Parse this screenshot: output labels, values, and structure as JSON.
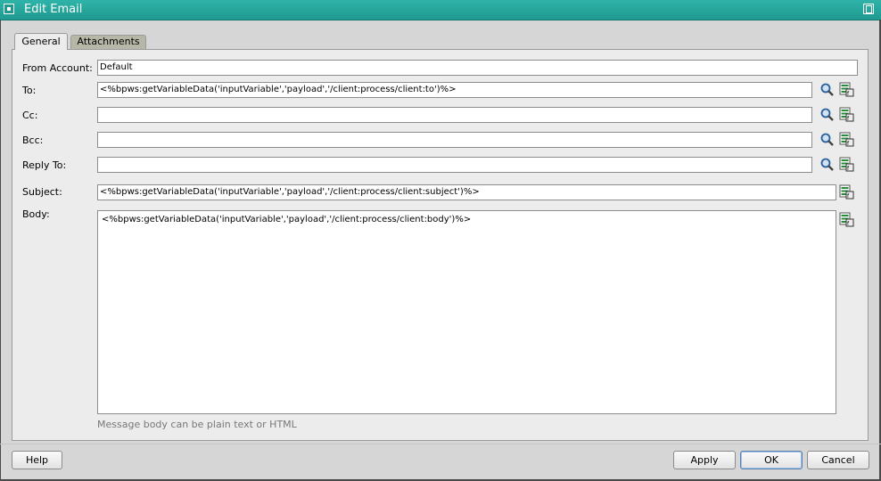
{
  "window": {
    "title": "Edit Email"
  },
  "tabs": [
    {
      "label": "General",
      "active": true
    },
    {
      "label": "Attachments",
      "active": false
    }
  ],
  "form": {
    "from_account": {
      "label": "From Account:",
      "value": "Default"
    },
    "to": {
      "label": "To:",
      "value": "<%bpws:getVariableData('inputVariable','payload','/client:process/client:to')%>"
    },
    "cc": {
      "label": "Cc:",
      "value": ""
    },
    "bcc": {
      "label": "Bcc:",
      "value": ""
    },
    "reply_to": {
      "label": "Reply To:",
      "value": ""
    },
    "subject": {
      "label": "Subject:",
      "value": "<%bpws:getVariableData('inputVariable','payload','/client:process/client:subject')%>"
    },
    "body": {
      "label": "Body:",
      "value": "<%bpws:getVariableData('inputVariable','payload','/client:process/client:body')%>"
    },
    "body_hint": "Message body can be plain text or HTML"
  },
  "buttons": {
    "help": "Help",
    "apply": "Apply",
    "ok": "OK",
    "cancel": "Cancel"
  },
  "icons": {
    "search": "magnifier-icon",
    "expression": "xpath-expression-builder-icon"
  },
  "colors": {
    "titlebar": "#1f9a90",
    "panel": "#ececec",
    "inactive_tab": "#b7b7a8"
  }
}
